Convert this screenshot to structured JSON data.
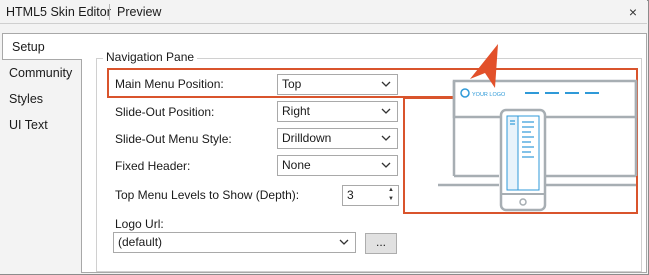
{
  "doc_tabs": {
    "editor": "HTML5 Skin Editor",
    "preview": "Preview",
    "close_glyph": "×"
  },
  "side_tabs": [
    {
      "label": "Setup"
    },
    {
      "label": "Community"
    },
    {
      "label": "Styles"
    },
    {
      "label": "UI Text"
    }
  ],
  "pane": {
    "group_title": "Navigation Pane",
    "main_menu_position": {
      "label": "Main Menu Position:",
      "value": "Top"
    },
    "slide_out_position": {
      "label": "Slide-Out Position:",
      "value": "Right"
    },
    "slide_out_menu_style": {
      "label": "Slide-Out Menu Style:",
      "value": "Drilldown"
    },
    "fixed_header": {
      "label": "Fixed Header:",
      "value": "None"
    },
    "top_menu_levels": {
      "label": "Top Menu Levels to Show (Depth):",
      "value": "3"
    },
    "logo_url": {
      "label": "Logo Url:",
      "value": "(default)",
      "browse_label": "..."
    }
  },
  "preview": {
    "logo_text": "YOUR LOGO"
  },
  "colors": {
    "highlight": "#d9542c",
    "illustration": "#a7aeb3",
    "illustration_accent": "#2f9ad8"
  }
}
